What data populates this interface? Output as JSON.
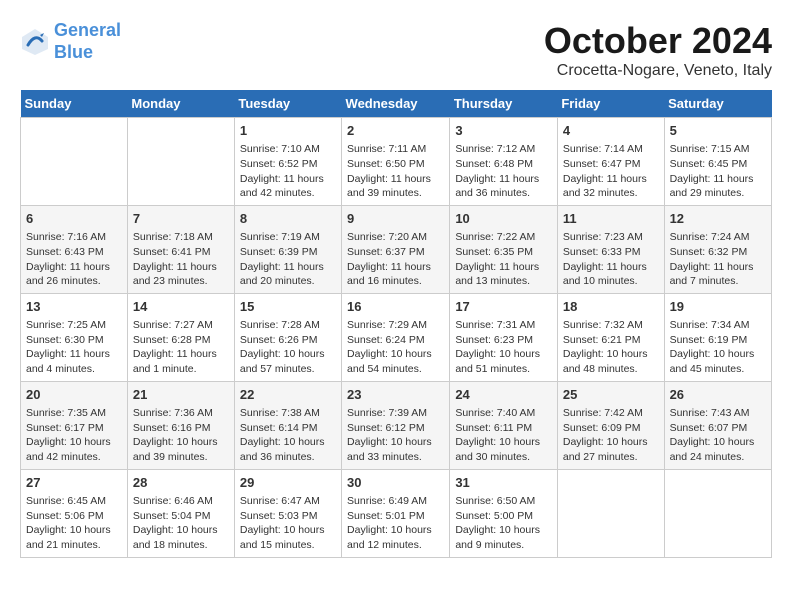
{
  "header": {
    "logo_line1": "General",
    "logo_line2": "Blue",
    "month_title": "October 2024",
    "location": "Crocetta-Nogare, Veneto, Italy"
  },
  "days_of_week": [
    "Sunday",
    "Monday",
    "Tuesday",
    "Wednesday",
    "Thursday",
    "Friday",
    "Saturday"
  ],
  "weeks": [
    [
      {
        "day": "",
        "info": ""
      },
      {
        "day": "",
        "info": ""
      },
      {
        "day": "1",
        "info": "Sunrise: 7:10 AM\nSunset: 6:52 PM\nDaylight: 11 hours and 42 minutes."
      },
      {
        "day": "2",
        "info": "Sunrise: 7:11 AM\nSunset: 6:50 PM\nDaylight: 11 hours and 39 minutes."
      },
      {
        "day": "3",
        "info": "Sunrise: 7:12 AM\nSunset: 6:48 PM\nDaylight: 11 hours and 36 minutes."
      },
      {
        "day": "4",
        "info": "Sunrise: 7:14 AM\nSunset: 6:47 PM\nDaylight: 11 hours and 32 minutes."
      },
      {
        "day": "5",
        "info": "Sunrise: 7:15 AM\nSunset: 6:45 PM\nDaylight: 11 hours and 29 minutes."
      }
    ],
    [
      {
        "day": "6",
        "info": "Sunrise: 7:16 AM\nSunset: 6:43 PM\nDaylight: 11 hours and 26 minutes."
      },
      {
        "day": "7",
        "info": "Sunrise: 7:18 AM\nSunset: 6:41 PM\nDaylight: 11 hours and 23 minutes."
      },
      {
        "day": "8",
        "info": "Sunrise: 7:19 AM\nSunset: 6:39 PM\nDaylight: 11 hours and 20 minutes."
      },
      {
        "day": "9",
        "info": "Sunrise: 7:20 AM\nSunset: 6:37 PM\nDaylight: 11 hours and 16 minutes."
      },
      {
        "day": "10",
        "info": "Sunrise: 7:22 AM\nSunset: 6:35 PM\nDaylight: 11 hours and 13 minutes."
      },
      {
        "day": "11",
        "info": "Sunrise: 7:23 AM\nSunset: 6:33 PM\nDaylight: 11 hours and 10 minutes."
      },
      {
        "day": "12",
        "info": "Sunrise: 7:24 AM\nSunset: 6:32 PM\nDaylight: 11 hours and 7 minutes."
      }
    ],
    [
      {
        "day": "13",
        "info": "Sunrise: 7:25 AM\nSunset: 6:30 PM\nDaylight: 11 hours and 4 minutes."
      },
      {
        "day": "14",
        "info": "Sunrise: 7:27 AM\nSunset: 6:28 PM\nDaylight: 11 hours and 1 minute."
      },
      {
        "day": "15",
        "info": "Sunrise: 7:28 AM\nSunset: 6:26 PM\nDaylight: 10 hours and 57 minutes."
      },
      {
        "day": "16",
        "info": "Sunrise: 7:29 AM\nSunset: 6:24 PM\nDaylight: 10 hours and 54 minutes."
      },
      {
        "day": "17",
        "info": "Sunrise: 7:31 AM\nSunset: 6:23 PM\nDaylight: 10 hours and 51 minutes."
      },
      {
        "day": "18",
        "info": "Sunrise: 7:32 AM\nSunset: 6:21 PM\nDaylight: 10 hours and 48 minutes."
      },
      {
        "day": "19",
        "info": "Sunrise: 7:34 AM\nSunset: 6:19 PM\nDaylight: 10 hours and 45 minutes."
      }
    ],
    [
      {
        "day": "20",
        "info": "Sunrise: 7:35 AM\nSunset: 6:17 PM\nDaylight: 10 hours and 42 minutes."
      },
      {
        "day": "21",
        "info": "Sunrise: 7:36 AM\nSunset: 6:16 PM\nDaylight: 10 hours and 39 minutes."
      },
      {
        "day": "22",
        "info": "Sunrise: 7:38 AM\nSunset: 6:14 PM\nDaylight: 10 hours and 36 minutes."
      },
      {
        "day": "23",
        "info": "Sunrise: 7:39 AM\nSunset: 6:12 PM\nDaylight: 10 hours and 33 minutes."
      },
      {
        "day": "24",
        "info": "Sunrise: 7:40 AM\nSunset: 6:11 PM\nDaylight: 10 hours and 30 minutes."
      },
      {
        "day": "25",
        "info": "Sunrise: 7:42 AM\nSunset: 6:09 PM\nDaylight: 10 hours and 27 minutes."
      },
      {
        "day": "26",
        "info": "Sunrise: 7:43 AM\nSunset: 6:07 PM\nDaylight: 10 hours and 24 minutes."
      }
    ],
    [
      {
        "day": "27",
        "info": "Sunrise: 6:45 AM\nSunset: 5:06 PM\nDaylight: 10 hours and 21 minutes."
      },
      {
        "day": "28",
        "info": "Sunrise: 6:46 AM\nSunset: 5:04 PM\nDaylight: 10 hours and 18 minutes."
      },
      {
        "day": "29",
        "info": "Sunrise: 6:47 AM\nSunset: 5:03 PM\nDaylight: 10 hours and 15 minutes."
      },
      {
        "day": "30",
        "info": "Sunrise: 6:49 AM\nSunset: 5:01 PM\nDaylight: 10 hours and 12 minutes."
      },
      {
        "day": "31",
        "info": "Sunrise: 6:50 AM\nSunset: 5:00 PM\nDaylight: 10 hours and 9 minutes."
      },
      {
        "day": "",
        "info": ""
      },
      {
        "day": "",
        "info": ""
      }
    ]
  ]
}
